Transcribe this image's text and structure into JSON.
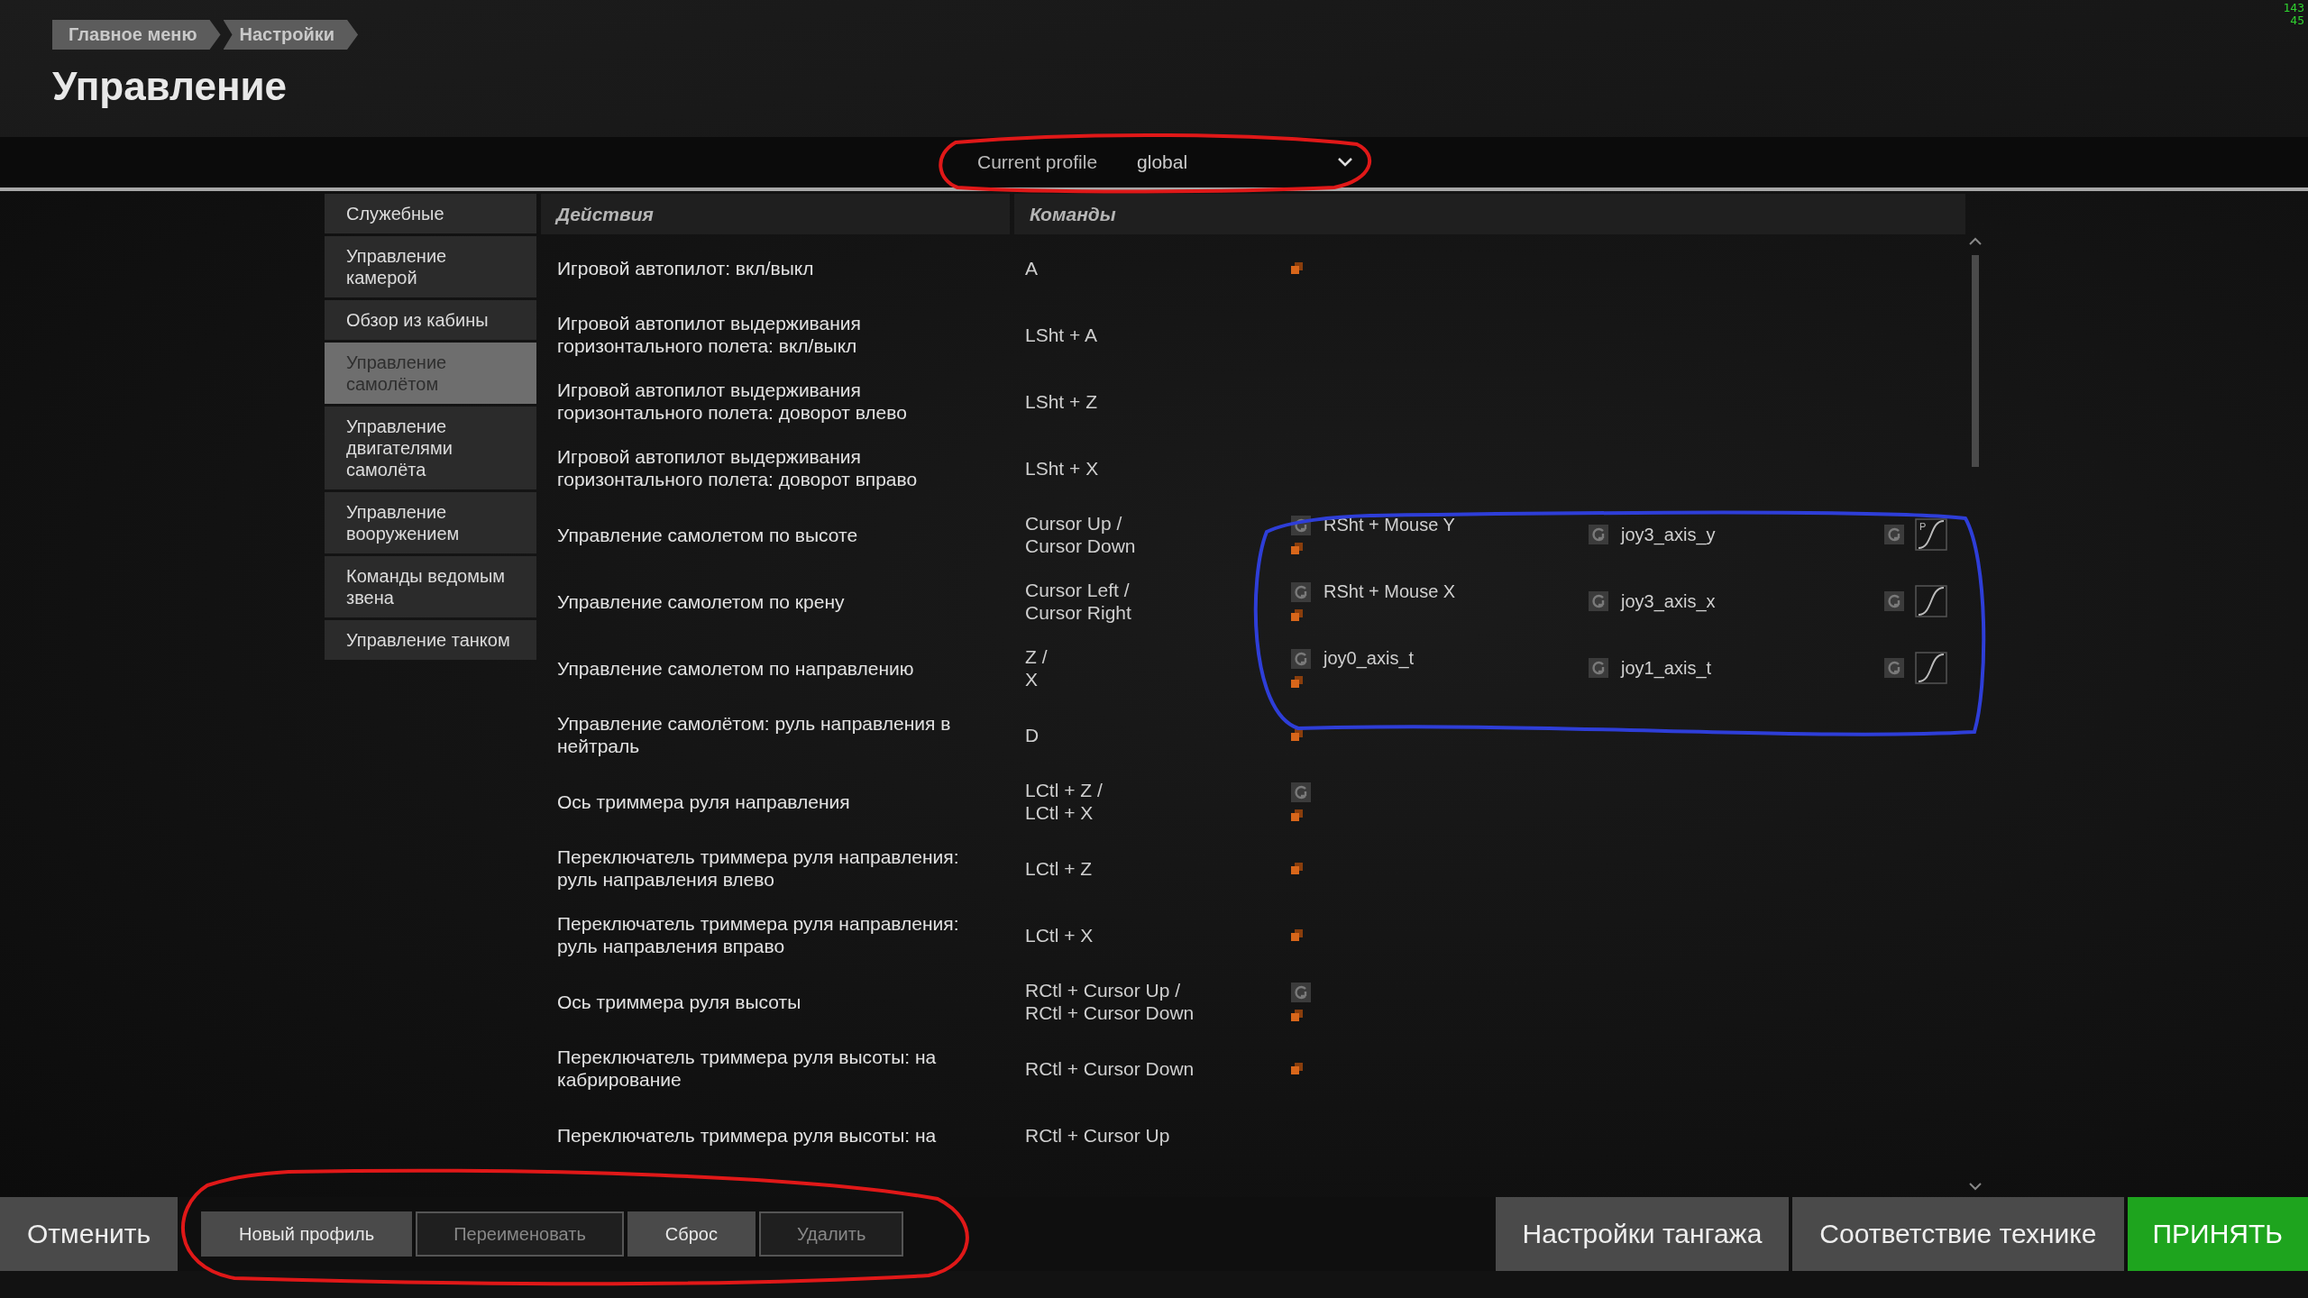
{
  "breadcrumbs": [
    {
      "label": "Главное меню"
    },
    {
      "label": "Настройки"
    }
  ],
  "title": "Управление",
  "fps": [
    "143",
    "45"
  ],
  "profile": {
    "label": "Current profile",
    "value": "global"
  },
  "sidebar": {
    "items": [
      {
        "label": "Служебные",
        "selected": false
      },
      {
        "label": "Управление камерой",
        "selected": false
      },
      {
        "label": "Обзор из кабины",
        "selected": false
      },
      {
        "label": "Управление самолётом",
        "selected": true
      },
      {
        "label": "Управление двигателями самолёта",
        "selected": false
      },
      {
        "label": "Управление вооружением",
        "selected": false
      },
      {
        "label": "Команды ведомым звена",
        "selected": false
      },
      {
        "label": "Управление танком",
        "selected": false
      }
    ]
  },
  "table": {
    "columns": [
      "Действия",
      "Команды"
    ],
    "rows": [
      {
        "action": "Игровой автопилот: вкл/выкл",
        "command": "A",
        "marker": true,
        "reset": false
      },
      {
        "action": "Игровой автопилот выдерживания горизонтального полета: вкл/выкл",
        "command": "LSht + A",
        "marker": false,
        "reset": false
      },
      {
        "action": "Игровой автопилот выдерживания горизонтального полета: доворот влево",
        "command": "LSht + Z",
        "marker": false,
        "reset": false
      },
      {
        "action": "Игровой автопилот выдерживания горизонтального полета: доворот вправо",
        "command": "LSht + X",
        "marker": false,
        "reset": false
      },
      {
        "action": "Управление самолетом по высоте",
        "command": "Cursor Up /\nCursor Down",
        "marker": true,
        "reset": true,
        "bindings": [
          "RSht + Mouse Y",
          "joy3_axis_y"
        ],
        "curve": {
          "label": "P"
        }
      },
      {
        "action": "Управление самолетом по крену",
        "command": "Cursor Left /\nCursor Right",
        "marker": true,
        "reset": true,
        "bindings": [
          "RSht + Mouse X",
          "joy3_axis_x"
        ],
        "curve": {}
      },
      {
        "action": "Управление самолетом по направлению",
        "command": "Z /\nX",
        "marker": true,
        "reset": true,
        "bindings": [
          "joy0_axis_t",
          "joy1_axis_t"
        ],
        "curve": {}
      },
      {
        "action": "Управление самолётом: руль направления в нейтраль",
        "command": "D",
        "marker": true,
        "reset": false
      },
      {
        "action": "Ось триммера руля направления",
        "command": "LCtl + Z /\nLCtl + X",
        "marker": true,
        "reset": true
      },
      {
        "action": "Переключатель триммера руля направления: руль направления влево",
        "command": "LCtl + Z",
        "marker": true,
        "reset": false
      },
      {
        "action": "Переключатель триммера руля направления: руль направления вправо",
        "command": "LCtl + X",
        "marker": true,
        "reset": false
      },
      {
        "action": "Ось триммера руля высоты",
        "command": "RCtl + Cursor Up /\nRCtl + Cursor Down",
        "marker": true,
        "reset": true
      },
      {
        "action": "Переключатель триммера руля высоты: на кабрирование",
        "command": "RCtl + Cursor Down",
        "marker": true,
        "reset": false
      },
      {
        "action": "Переключатель триммера руля высоты: на",
        "command": "RCtl + Cursor Up",
        "marker": false,
        "reset": false
      }
    ]
  },
  "footer": {
    "left": [
      {
        "label": "Отменить",
        "kind": "default"
      }
    ],
    "profile_buttons": [
      {
        "label": "Новый профиль",
        "disabled": false
      },
      {
        "label": "Переименовать",
        "disabled": true
      },
      {
        "label": "Сброс",
        "disabled": false
      },
      {
        "label": "Удалить",
        "disabled": true
      }
    ],
    "right": [
      {
        "label": "Настройки тангажа",
        "kind": "default"
      },
      {
        "label": "Соответствие технике",
        "kind": "default"
      },
      {
        "label": "ПРИНЯТЬ",
        "kind": "primary"
      }
    ]
  }
}
